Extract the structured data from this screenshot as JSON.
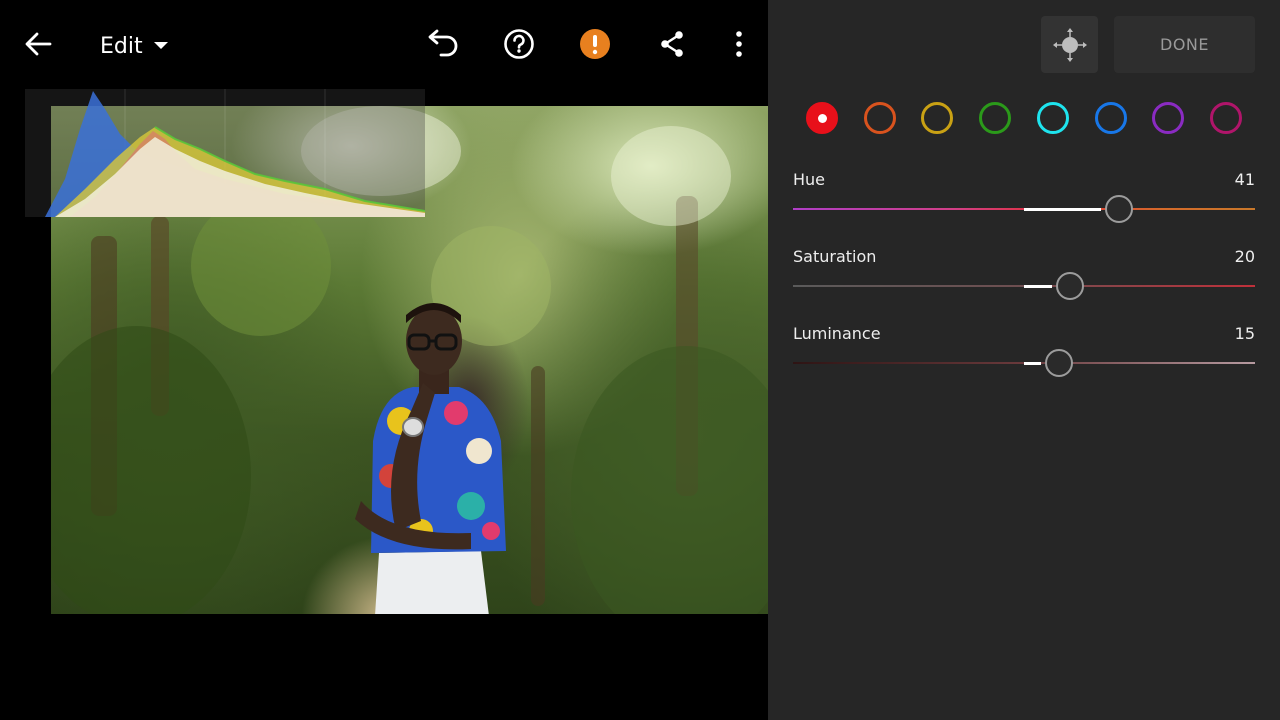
{
  "app": {
    "edit_label": "Edit"
  },
  "toolbar": {
    "back_icon": "arrow-left-icon",
    "undo_icon": "undo-icon",
    "help_icon": "question-circle-icon",
    "warning_icon": "exclamation-circle-icon",
    "share_icon": "share-icon",
    "more_icon": "more-vertical-icon",
    "warning_color": "#e8801f"
  },
  "panel": {
    "done_label": "DONE",
    "target_icon": "targeted-adjustment-icon",
    "colors": [
      {
        "name": "red",
        "hex": "#e8101a",
        "selected": true
      },
      {
        "name": "orange",
        "hex": "#d9531e",
        "selected": false
      },
      {
        "name": "yellow",
        "hex": "#c9a114",
        "selected": false
      },
      {
        "name": "green",
        "hex": "#2b9a1a",
        "selected": false
      },
      {
        "name": "aqua",
        "hex": "#1ee4ee",
        "selected": false
      },
      {
        "name": "blue",
        "hex": "#1877e8",
        "selected": false
      },
      {
        "name": "purple",
        "hex": "#8a2bc2",
        "selected": false
      },
      {
        "name": "magenta",
        "hex": "#b0156a",
        "selected": false
      }
    ],
    "sliders": [
      {
        "label": "Hue",
        "value": "41",
        "min": -100,
        "max": 100,
        "amount": 41
      },
      {
        "label": "Saturation",
        "value": "20",
        "min": -100,
        "max": 100,
        "amount": 20
      },
      {
        "label": "Luminance",
        "value": "15",
        "min": -100,
        "max": 100,
        "amount": 15
      }
    ]
  }
}
